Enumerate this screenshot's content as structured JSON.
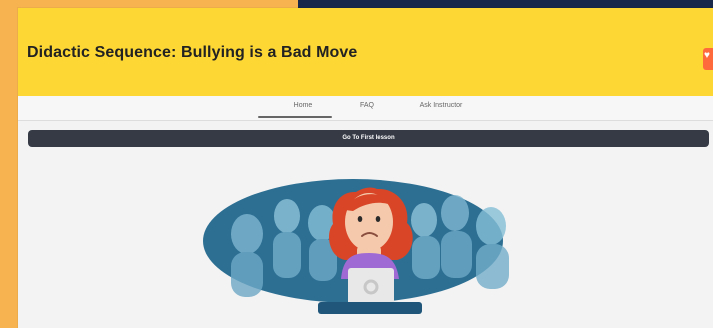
{
  "header": {
    "title": "Didactic Sequence: Bullying is a Bad Move"
  },
  "nav": {
    "items": [
      {
        "label": "Home"
      },
      {
        "label": "FAQ"
      },
      {
        "label": "Ask Instructor"
      }
    ]
  },
  "actions": {
    "primary": "Go To First lesson"
  },
  "colors": {
    "page_background": "#f7b34f",
    "header_background": "#fdd835",
    "dark_button": "#353a45",
    "accent": "#ff6a3d"
  },
  "icons": {
    "corner": "heart-icon"
  }
}
